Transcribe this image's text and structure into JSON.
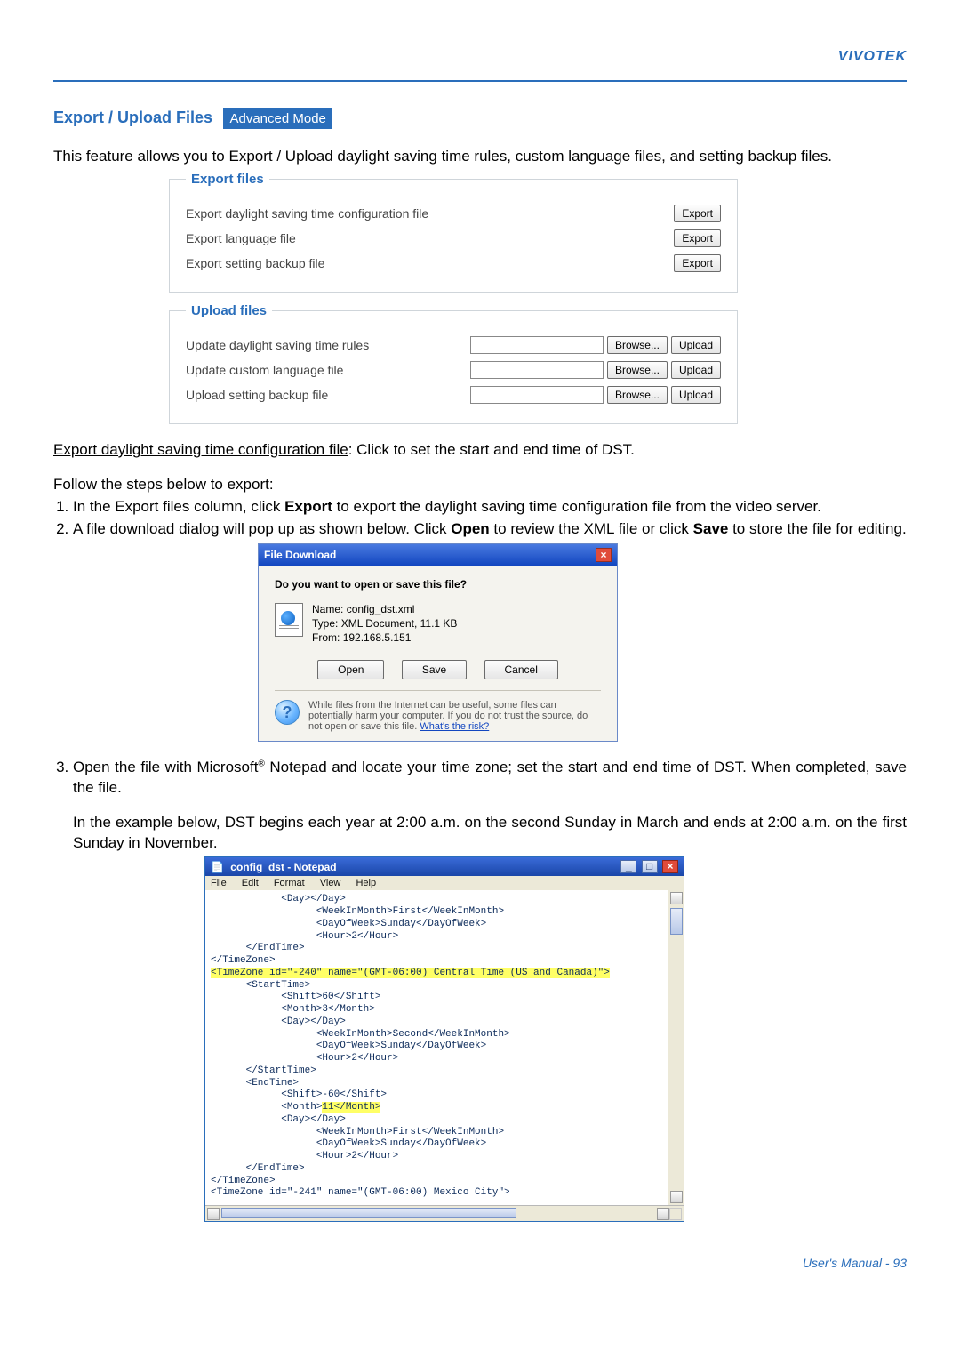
{
  "brand": "VIVOTEK",
  "section": {
    "title": "Export / Upload Files",
    "badge": "Advanced Mode"
  },
  "intro": "This feature allows you to Export / Upload daylight saving time rules, custom language files, and setting backup files.",
  "panel": {
    "export": {
      "legend": "Export files",
      "rows": [
        {
          "label": "Export daylight saving time configuration file",
          "btn": "Export"
        },
        {
          "label": "Export language file",
          "btn": "Export"
        },
        {
          "label": "Export setting backup file",
          "btn": "Export"
        }
      ]
    },
    "upload": {
      "legend": "Upload files",
      "rows": [
        {
          "label": "Update daylight saving time rules",
          "browse": "Browse...",
          "upload": "Upload"
        },
        {
          "label": "Update custom language file",
          "browse": "Browse...",
          "upload": "Upload"
        },
        {
          "label": "Upload setting backup file",
          "browse": "Browse...",
          "upload": "Upload"
        }
      ]
    }
  },
  "para1_underlined": "Export daylight saving time configuration file",
  "para1_rest": ": Click to set the start and end time of DST.",
  "para_follow": "Follow the steps below to export:",
  "step1_a": "In the Export files column, click ",
  "step1_b": "Export",
  "step1_c": " to export the daylight saving time configuration file from the video server.",
  "step2_a": "A file download dialog will pop up as shown below. Click ",
  "step2_b": "Open",
  "step2_c": " to review the XML file or click ",
  "step2_d": "Save",
  "step2_e": " to store the file for editing.",
  "dialog": {
    "title": "File Download",
    "question": "Do you want to open or save this file?",
    "meta": {
      "name_lbl": "Name:",
      "name": "config_dst.xml",
      "type_lbl": "Type:",
      "type": "XML Document, 11.1 KB",
      "from_lbl": "From:",
      "from": "192.168.5.151"
    },
    "buttons": {
      "open": "Open",
      "save": "Save",
      "cancel": "Cancel"
    },
    "warn": "While files from the Internet can be useful, some files can potentially harm your computer. If you do not trust the source, do not open or save this file. ",
    "warn_link": "What's the risk?"
  },
  "step3_a": "Open the file with Microsoft",
  "step3_b": " Notepad and locate your time zone; set the start and end time of DST. When completed, save the file.",
  "example": "In the example below, DST begins each year at 2:00 a.m. on the second Sunday in March and ends at 2:00 a.m. on the first Sunday in November.",
  "notepad": {
    "title": "config_dst - Notepad",
    "menu": {
      "file": "File",
      "edit": "Edit",
      "format": "Format",
      "view": "View",
      "help": "Help"
    },
    "pre1": "            <Day></Day>\n                  <WeekInMonth>First</WeekInMonth>\n                  <DayOfWeek>Sunday</DayOfWeek>\n                  <Hour>2</Hour>\n      </EndTime>\n</TimeZone>",
    "hi1": "<TimeZone id=\"-240\" name=\"(GMT-06:00) Central Time (US and Canada)\">",
    "pre2": "\n      <StartTime>\n            <Shift>60</Shift>\n            <Month>3</Month>\n            <Day></Day>\n                  <WeekInMonth>Second</WeekInMonth>\n                  <DayOfWeek>Sunday</DayOfWeek>\n                  <Hour>2</Hour>\n      </StartTime>\n      <EndTime>\n            <Shift>-60</Shift>\n            <Month>",
    "hi2": "11</Month>",
    "pre3": "\n            <Day></Day>\n                  <WeekInMonth>First</WeekInMonth>\n                  <DayOfWeek>Sunday</DayOfWeek>\n                  <Hour>2</Hour>\n      </EndTime>\n</TimeZone>\n<TimeZone id=\"-241\" name=\"(GMT-06:00) Mexico City\">"
  },
  "footer": "User's Manual - 93"
}
